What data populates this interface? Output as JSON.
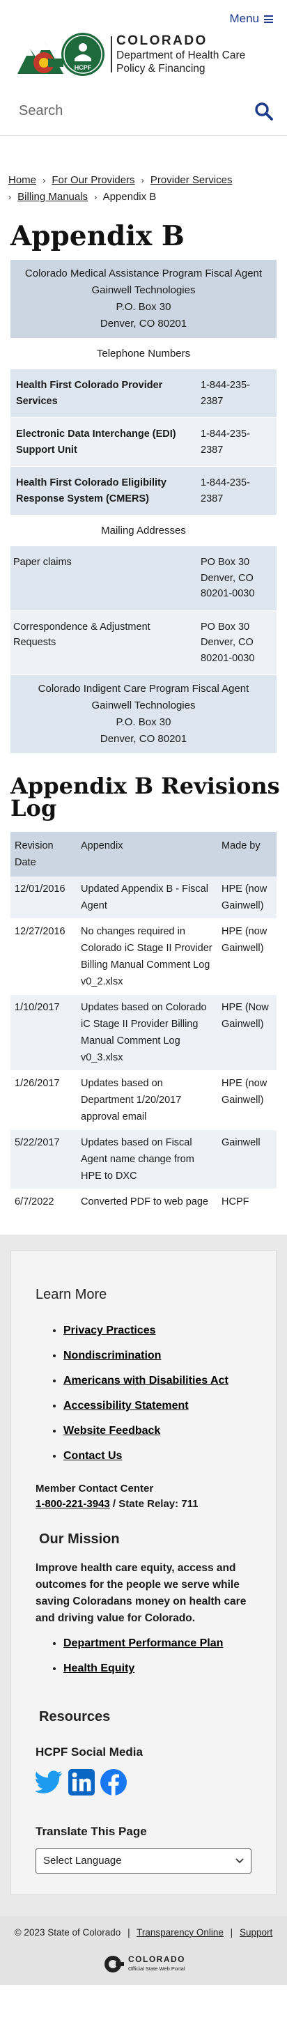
{
  "header": {
    "menu_label": "Menu",
    "agency_state": "COLORADO",
    "agency_dept_line1": "Department of Health Care",
    "agency_dept_line2": "Policy & Financing",
    "badge_text": "HCPF",
    "colors": {
      "brand_blue": "#1b3a8c",
      "logo_green": "#1e6a3c",
      "logo_gold": "#f2c21b",
      "logo_red": "#c0392b"
    }
  },
  "search": {
    "placeholder": "Search"
  },
  "breadcrumb": {
    "items": [
      {
        "label": "Home",
        "link": true
      },
      {
        "label": "For Our Providers",
        "link": true
      },
      {
        "label": "Provider Services",
        "link": true
      },
      {
        "label": "Billing Manuals",
        "link": true
      },
      {
        "label": "Appendix B",
        "link": false
      }
    ]
  },
  "page_title": "Appendix B",
  "fiscal_agent": {
    "line1": "Colorado Medical Assistance Program Fiscal Agent",
    "line2": "Gainwell Technologies",
    "line3": "P.O. Box 30",
    "line4": "Denver, CO 80201"
  },
  "telephone": {
    "heading": "Telephone Numbers",
    "rows": [
      {
        "label": "Health First Colorado Provider Services",
        "value": "1-844-235-2387"
      },
      {
        "label": "Electronic Data Interchange (EDI) Support Unit",
        "value": "1-844-235-2387"
      },
      {
        "label": "Health First Colorado Eligibility Response System (CMERS)",
        "value": "1-844-235-2387"
      }
    ]
  },
  "mailing": {
    "heading": "Mailing Addresses",
    "rows": [
      {
        "label": "Paper claims",
        "value": "PO Box 30 Denver, CO 80201-0030"
      },
      {
        "label": "Correspondence & Adjustment Requests",
        "value": "PO Box 30 Denver, CO 80201-0030"
      }
    ]
  },
  "indigent": {
    "line1": "Colorado Indigent Care Program Fiscal Agent",
    "line2": "Gainwell Technologies",
    "line3": "P.O. Box 30",
    "line4": "Denver, CO 80201"
  },
  "revisions": {
    "title": "Appendix B Revisions Log",
    "headers": [
      "Revision Date",
      "Appendix",
      "Made by"
    ],
    "rows": [
      [
        "12/01/2016",
        "Updated Appendix B - Fiscal Agent",
        "HPE (now Gainwell)"
      ],
      [
        "12/27/2016",
        "No changes required in Colorado iC Stage II Provider Billing Manual Comment Log v0_2.xlsx",
        "HPE (now Gainwell)"
      ],
      [
        "1/10/2017",
        "Updates based on Colorado iC Stage II Provider Billing Manual Comment Log v0_3.xlsx",
        "HPE (Now Gainwell)"
      ],
      [
        "1/26/2017",
        "Updates based on Department 1/20/2017 approval email",
        "HPE (now Gainwell)"
      ],
      [
        "5/22/2017",
        "Updates based on Fiscal Agent name change from HPE to DXC",
        "Gainwell"
      ],
      [
        "6/7/2022",
        "Converted PDF to web page",
        "HCPF"
      ]
    ]
  },
  "footer": {
    "learn_more_heading": "Learn More",
    "learn_more_links": [
      "Privacy Practices",
      "Nondiscrimination",
      "Americans with Disabilities Act",
      "Accessibility Statement",
      "Website Feedback",
      "Contact Us"
    ],
    "contact_label": "Member Contact Center",
    "contact_phone": "1-800-221-3943",
    "contact_relay": " / State Relay: 711",
    "mission_heading": "Our Mission",
    "mission_text": "Improve health care equity, access and outcomes for the people we serve while saving Coloradans money on health care and driving value for Colorado.",
    "mission_links": [
      "Department Performance Plan",
      "Health Equity"
    ],
    "resources_heading": "Resources",
    "social_heading": "HCPF Social Media",
    "social_icons": [
      "twitter-icon",
      "linkedin-icon",
      "facebook-icon"
    ],
    "translate_heading": "Translate This Page",
    "select_value": "Select Language",
    "copyright": "© 2023 State of Colorado",
    "transparency_label": "Transparency Online",
    "support_label": "Support",
    "portal_title": "COLORADO",
    "portal_subtitle": "Official State Web Portal"
  }
}
